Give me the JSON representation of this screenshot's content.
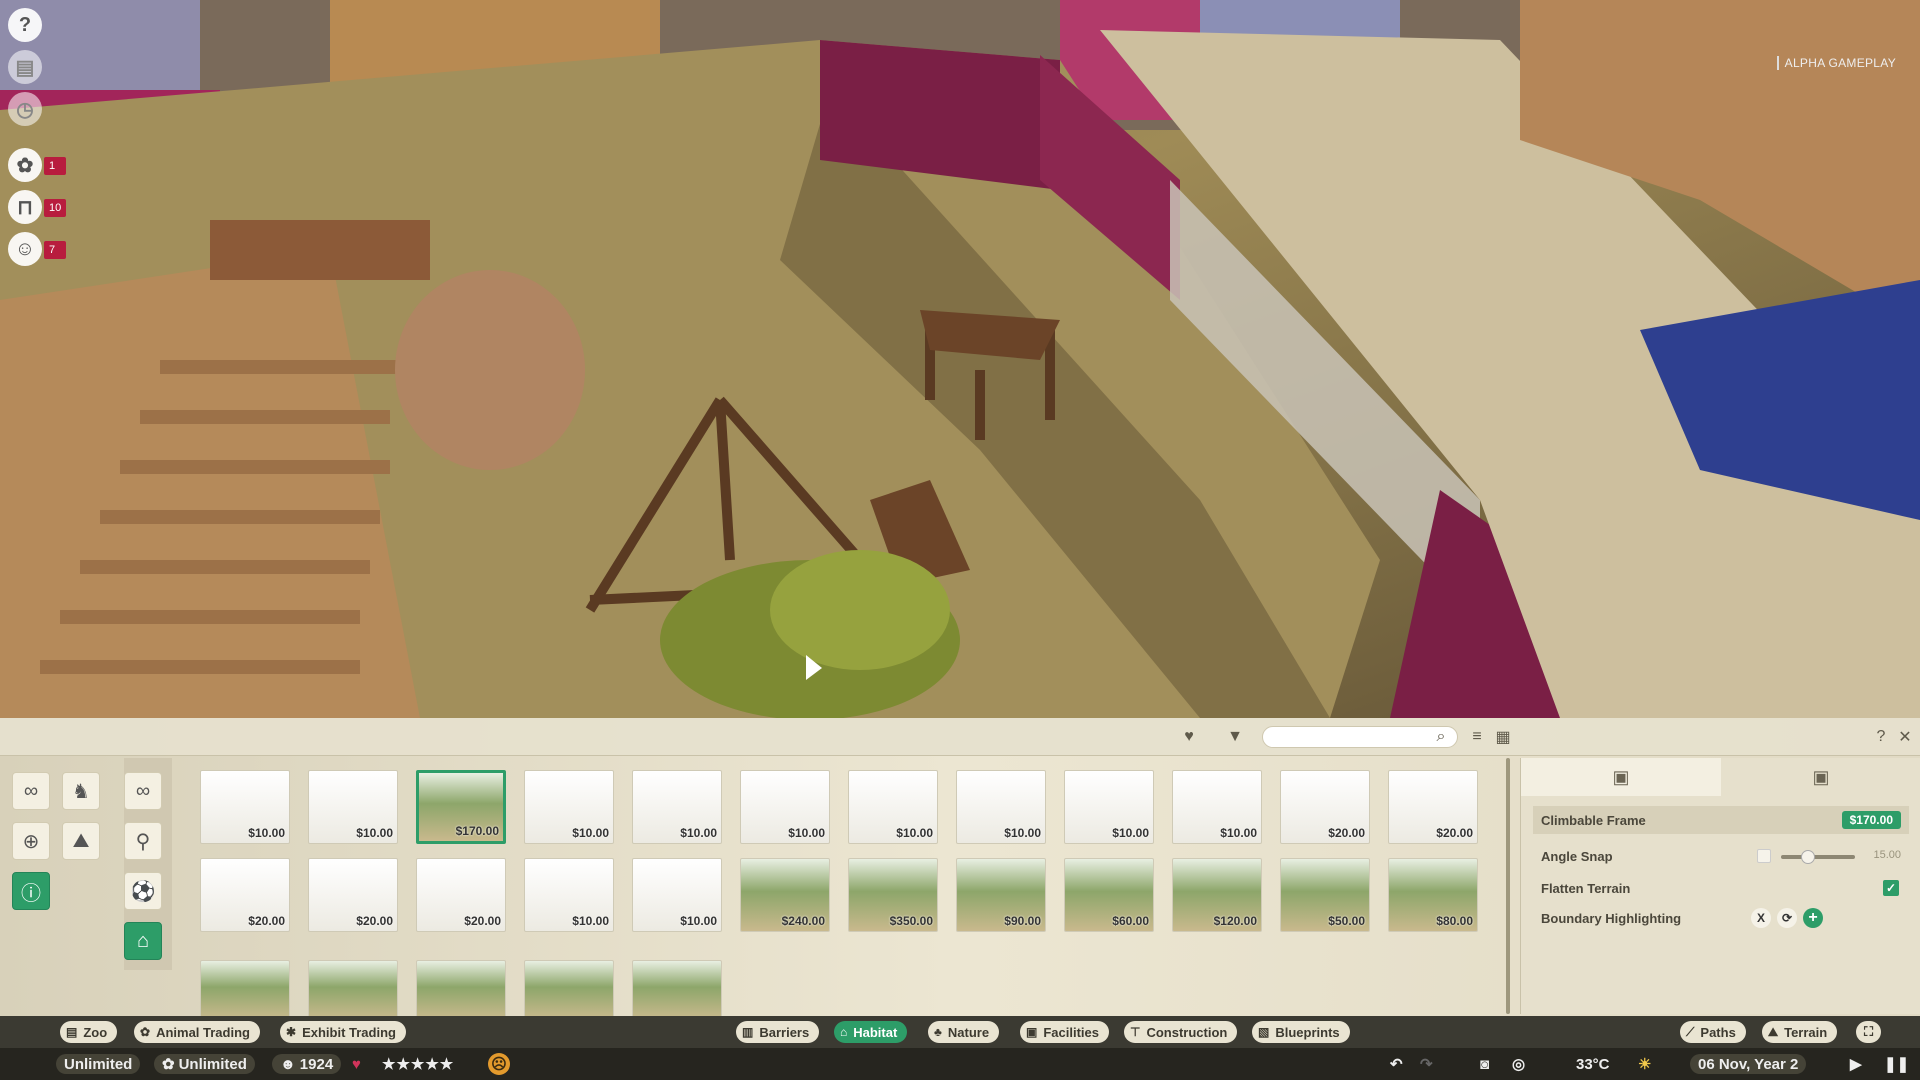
{
  "hud": {
    "animals_count": "1",
    "staff_count": "10",
    "guests_count": "7",
    "overlay_label": "ALPHA GAMEPLAY"
  },
  "toolbar": {
    "search_placeholder": "",
    "icons": [
      "heart-icon",
      "filter-icon",
      "search-icon",
      "sort-icon",
      "grid-view-icon",
      "help-icon",
      "close-icon"
    ]
  },
  "categories": [
    "infinity-icon",
    "animal-icon",
    "enrichment-icon",
    "terrain-icon",
    "habitat-info-icon",
    "infinity-icon",
    "meat-icon",
    "ball-icon",
    "climbing-icon"
  ],
  "items": [
    {
      "price": "$10.00"
    },
    {
      "price": "$10.00"
    },
    {
      "price": "$170.00"
    },
    {
      "price": "$10.00"
    },
    {
      "price": "$10.00"
    },
    {
      "price": "$10.00"
    },
    {
      "price": "$10.00"
    },
    {
      "price": "$10.00"
    },
    {
      "price": "$10.00"
    },
    {
      "price": "$10.00"
    },
    {
      "price": "$20.00"
    },
    {
      "price": "$20.00"
    },
    {
      "price": "$20.00"
    },
    {
      "price": "$20.00"
    },
    {
      "price": "$20.00"
    },
    {
      "price": "$10.00"
    },
    {
      "price": "$10.00"
    },
    {
      "price": "$240.00"
    },
    {
      "price": "$350.00"
    },
    {
      "price": "$90.00"
    },
    {
      "price": "$60.00"
    },
    {
      "price": "$120.00"
    },
    {
      "price": "$50.00"
    },
    {
      "price": "$80.00"
    },
    {
      "price": ""
    },
    {
      "price": ""
    },
    {
      "price": ""
    },
    {
      "price": ""
    },
    {
      "price": ""
    }
  ],
  "info": {
    "item_name": "Climbable Frame",
    "item_price": "$170.00",
    "angle_snap_label": "Angle Snap",
    "angle_snap_value": "15.00",
    "flatten_label": "Flatten Terrain",
    "flatten_checked": true,
    "boundary_label": "Boundary Highlighting",
    "boundary_x": "X"
  },
  "tabs_left": [
    "Zoo",
    "Animal Trading",
    "Exhibit Trading"
  ],
  "tabs_center": [
    "Barriers",
    "Habitat",
    "Nature",
    "Facilities",
    "Construction",
    "Blueprints"
  ],
  "active_tab": "Habitat",
  "tabs_right": [
    "Paths",
    "Terrain"
  ],
  "status": {
    "money": "Unlimited",
    "research": "Unlimited",
    "guests": "1924",
    "rating_stars": 5,
    "temperature": "33°C",
    "date": "06 Nov, Year 2"
  },
  "colors": {
    "accent": "#2d9d68",
    "badge": "#b81c3e",
    "wall": "#7a1f45"
  }
}
